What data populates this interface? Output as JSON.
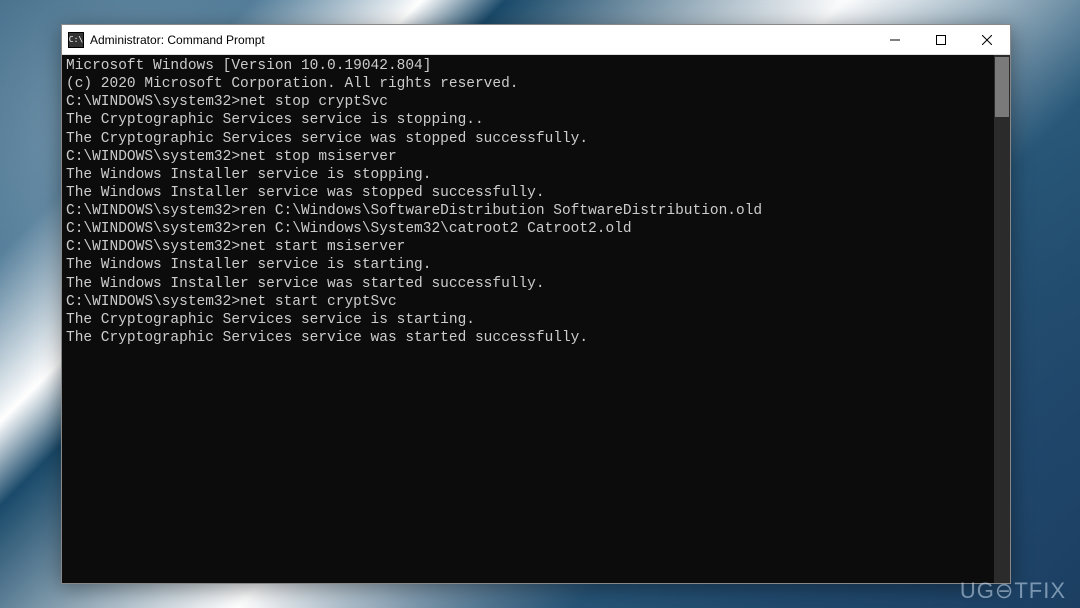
{
  "window": {
    "title": "Administrator: Command Prompt",
    "icon_label": "C:\\"
  },
  "console": {
    "prompt": "C:\\WINDOWS\\system32>",
    "header": [
      "Microsoft Windows [Version 10.0.19042.804]",
      "(c) 2020 Microsoft Corporation. All rights reserved."
    ],
    "blocks": [
      {
        "cmd": "net stop cryptSvc",
        "out": [
          "The Cryptographic Services service is stopping..",
          "The Cryptographic Services service was stopped successfully."
        ]
      },
      {
        "cmd": "net stop msiserver",
        "out": [
          "The Windows Installer service is stopping.",
          "The Windows Installer service was stopped successfully."
        ]
      },
      {
        "cmd": "ren C:\\Windows\\SoftwareDistribution SoftwareDistribution.old",
        "out": []
      },
      {
        "cmd": "ren C:\\Windows\\System32\\catroot2 Catroot2.old",
        "out": []
      },
      {
        "cmd": "net start msiserver",
        "out": [
          "The Windows Installer service is starting.",
          "The Windows Installer service was started successfully."
        ]
      },
      {
        "cmd": "net start cryptSvc",
        "out": [
          "The Cryptographic Services service is starting.",
          "The Cryptographic Services service was started successfully."
        ]
      }
    ]
  },
  "watermark": "UG⊖TFIX"
}
